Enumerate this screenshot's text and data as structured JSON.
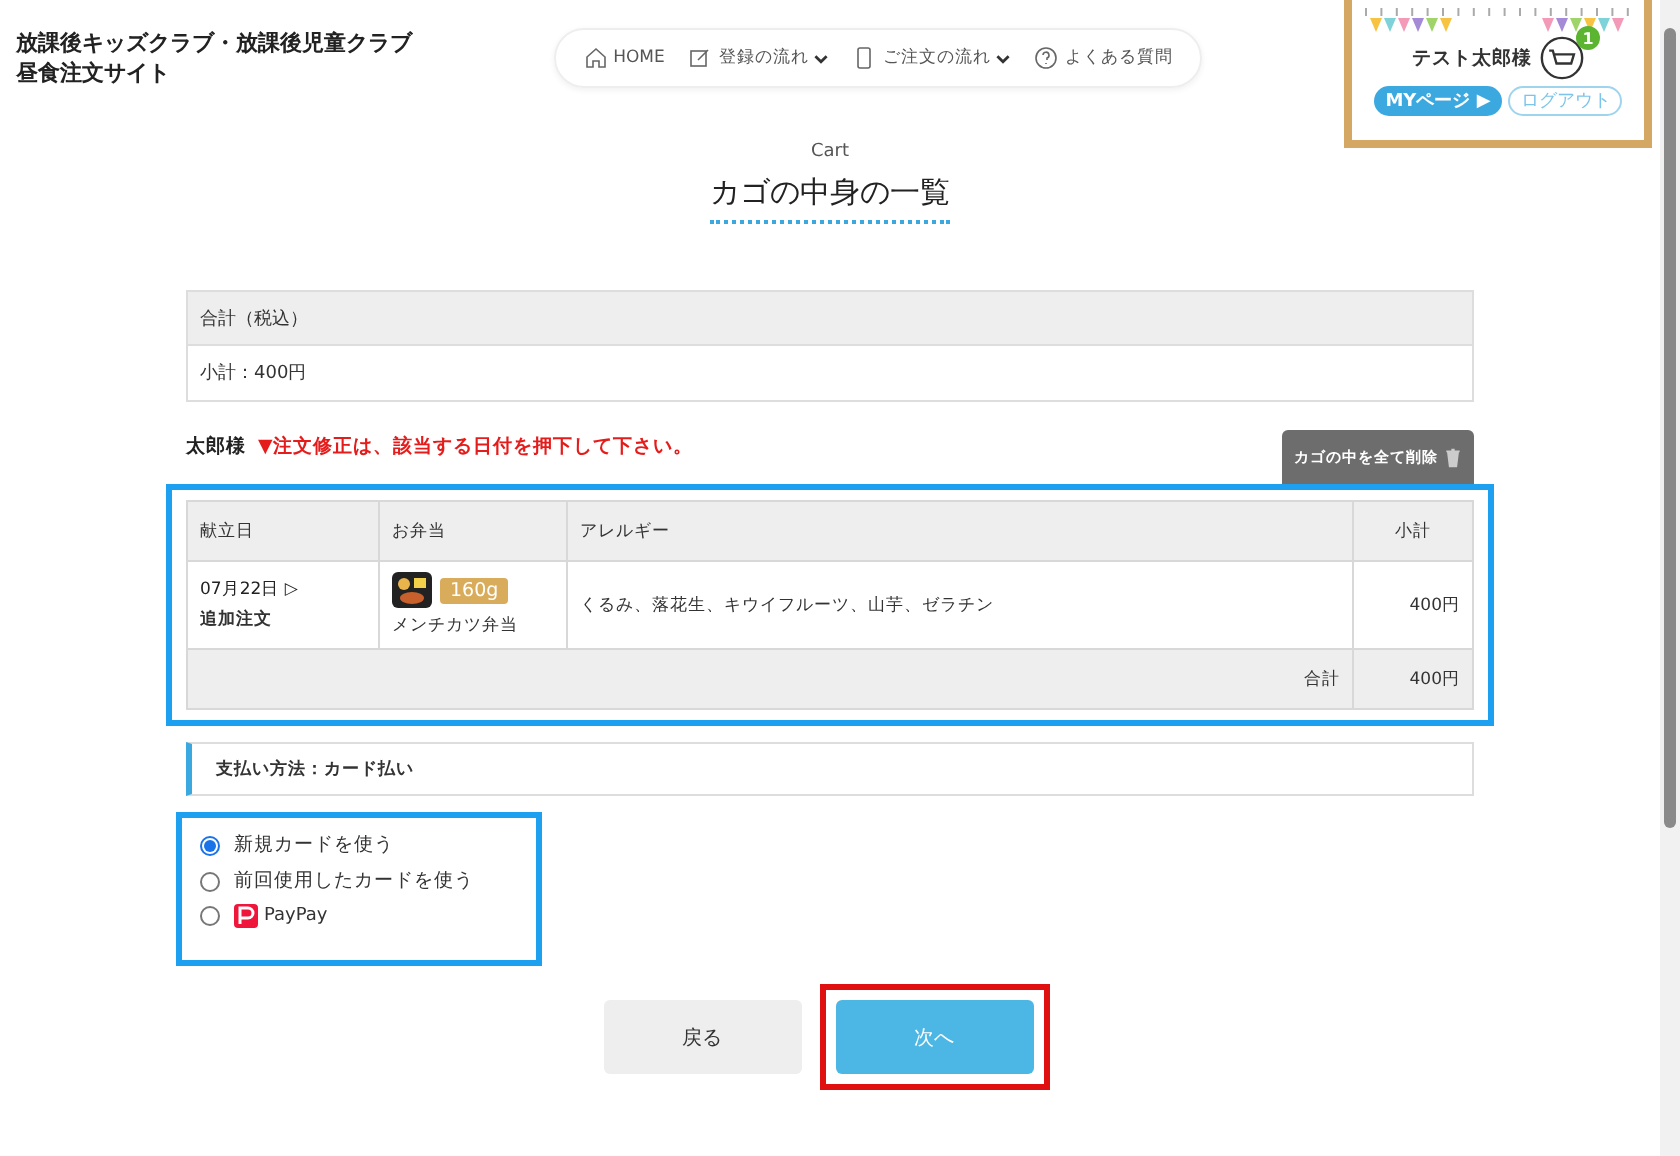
{
  "header": {
    "site_title": [
      "放課後キッズクラブ・放課後児童クラブ",
      "昼食注文サイト"
    ],
    "nav": [
      {
        "label": "HOME",
        "kind": "home",
        "dropdown": false
      },
      {
        "label": "登録の流れ",
        "kind": "edit",
        "dropdown": true
      },
      {
        "label": "ご注文の流れ",
        "kind": "phone",
        "dropdown": true
      },
      {
        "label": "よくある質問",
        "kind": "help",
        "dropdown": false
      }
    ],
    "account": {
      "name": "テスト太郎様",
      "cart_count": "1",
      "mypage": "MYページ ▶",
      "logout": "ログアウト"
    }
  },
  "page": {
    "eyebrow": "Cart",
    "title": "カゴの中身の一覧"
  },
  "summary": {
    "heading": "合計（税込）",
    "subtotal": "小計：400円"
  },
  "notice": {
    "name": "太郎様",
    "message": "▼注文修正は、該当する日付を押下して下さい。"
  },
  "delete_all": "カゴの中を全て削除",
  "table": {
    "columns": [
      "献立日",
      "お弁当",
      "アレルギー",
      "小計"
    ],
    "rows": [
      {
        "date": "07月22日 ▷",
        "tag": "追加注文",
        "weight": "160g",
        "bento": "メンチカツ弁当",
        "allergens": "くるみ、落花生、キウイフルーツ、山芋、ゼラチン",
        "subtotal": "400円"
      }
    ],
    "total_label": "合計",
    "total": "400円"
  },
  "payment": {
    "label": "支払い方法：カード払い",
    "options": [
      {
        "kind": "text",
        "label": "新規カードを使う",
        "selected": true
      },
      {
        "kind": "text",
        "label": "前回使用したカードを使う",
        "selected": false
      },
      {
        "kind": "paypay",
        "label": "PayPay",
        "selected": false
      }
    ]
  },
  "buttons": {
    "back": "戻る",
    "next": "次へ"
  }
}
